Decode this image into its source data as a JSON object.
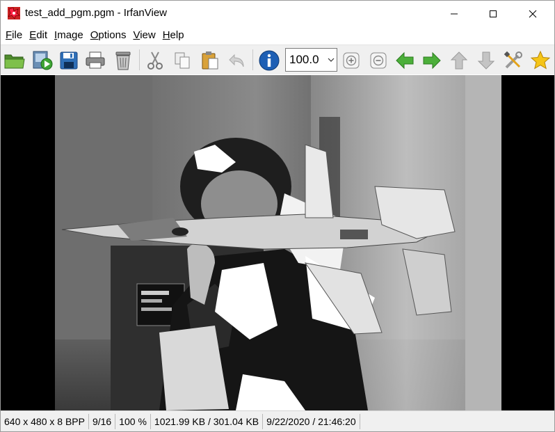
{
  "window": {
    "title": "test_add_pgm.pgm - IrfanView"
  },
  "menu": [
    {
      "label": "File",
      "key": "F",
      "rest": "ile"
    },
    {
      "label": "Edit",
      "key": "E",
      "rest": "dit"
    },
    {
      "label": "Image",
      "key": "I",
      "rest": "mage"
    },
    {
      "label": "Options",
      "key": "O",
      "rest": "ptions"
    },
    {
      "label": "View",
      "key": "V",
      "rest": "iew"
    },
    {
      "label": "Help",
      "key": "H",
      "rest": "elp"
    }
  ],
  "toolbar": {
    "icons": [
      "open-folder-icon",
      "slideshow-icon",
      "save-icon",
      "print-icon",
      "delete-icon",
      "cut-icon",
      "copy-icon",
      "paste-icon",
      "undo-icon",
      "info-icon",
      "zoom-in-icon",
      "zoom-out-icon",
      "previous-icon",
      "next-icon",
      "up-icon",
      "down-icon",
      "properties-icon",
      "favorite-icon"
    ],
    "zoom_value": "100.0"
  },
  "status": {
    "dimensions": "640 x 480 x 8 BPP",
    "index": "9/16",
    "zoom": "100 %",
    "size": "1021.99 KB / 301.04 KB",
    "datetime": "9/22/2020 / 21:46:20"
  },
  "colors": {
    "canvas_background": "#000000",
    "toolbar_background": "#f0f0f0",
    "arrow_green": "#3fa535",
    "arrow_gray": "#b8b8b8",
    "info_blue": "#1e5fb4",
    "star_yellow": "#f5c518"
  }
}
